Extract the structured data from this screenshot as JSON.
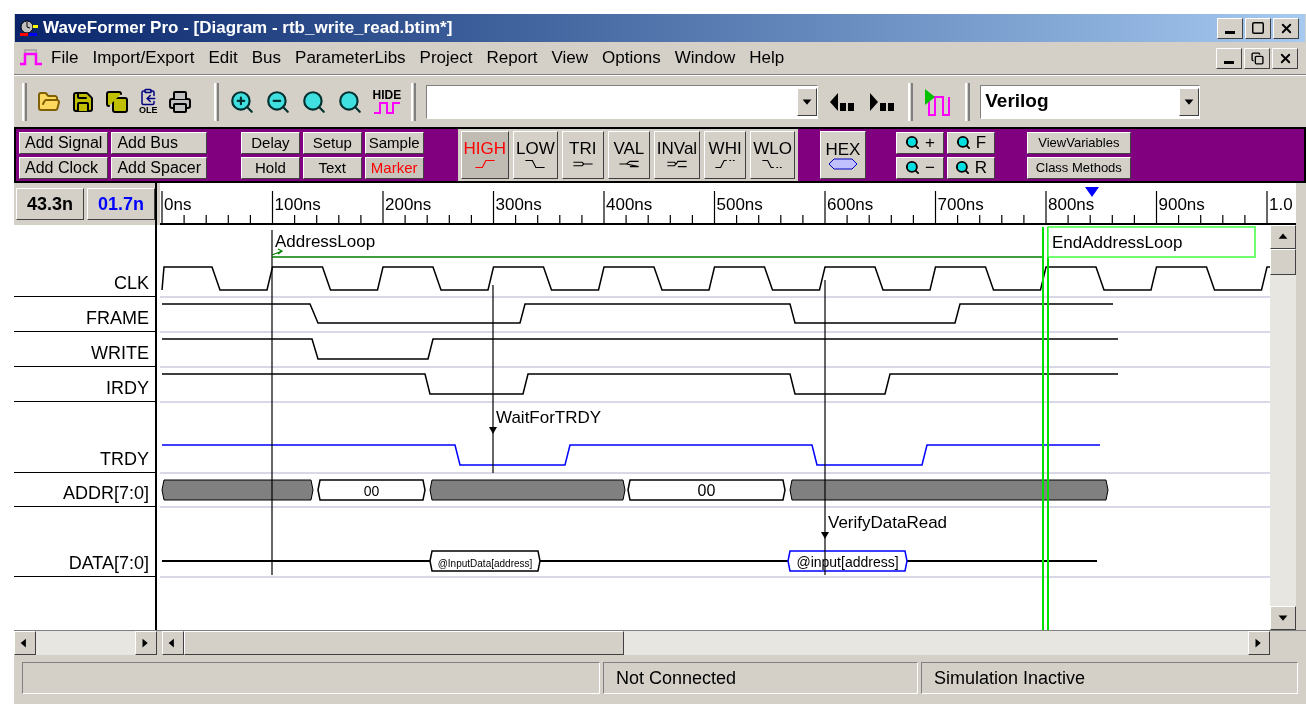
{
  "window": {
    "title": "WaveFormer Pro - [Diagram - rtb_write_read.btim*]"
  },
  "menu": [
    {
      "label": "File"
    },
    {
      "label": "Import/Export"
    },
    {
      "label": "Edit"
    },
    {
      "label": "Bus"
    },
    {
      "label": "ParameterLibs"
    },
    {
      "label": "Project"
    },
    {
      "label": "Report"
    },
    {
      "label": "View"
    },
    {
      "label": "Options"
    },
    {
      "label": "Window"
    },
    {
      "label": "Help"
    }
  ],
  "toolbar": {
    "hide_label": "HIDE",
    "ole_label": "OLE",
    "language": "Verilog"
  },
  "palette": {
    "add_buttons": [
      "Add Signal",
      "Add Bus",
      "Add Clock",
      "Add Spacer"
    ],
    "param_buttons": [
      {
        "label": "Delay",
        "selected": false
      },
      {
        "label": "Setup",
        "selected": false
      },
      {
        "label": "Sample",
        "selected": false
      },
      {
        "label": "Hold",
        "selected": false
      },
      {
        "label": "Text",
        "selected": false
      },
      {
        "label": "Marker",
        "selected": true
      }
    ],
    "state_buttons": [
      {
        "label": "HIGH",
        "selected": true
      },
      {
        "label": "LOW",
        "selected": false
      },
      {
        "label": "TRI",
        "selected": false
      },
      {
        "label": "VAL",
        "selected": false
      },
      {
        "label": "INVal",
        "selected": false
      },
      {
        "label": "WHI",
        "selected": false
      },
      {
        "label": "WLO",
        "selected": false
      }
    ],
    "hex_button": "HEX",
    "zoom_buttons": [
      "+",
      "F",
      "−",
      "R"
    ],
    "view_buttons": [
      "ViewVariables",
      "Class Methods"
    ]
  },
  "time_display": {
    "cursor": "43.3n",
    "delta": "01.7n"
  },
  "ruler": {
    "ticks": [
      "0ns",
      "100ns",
      "200ns",
      "300ns",
      "400ns",
      "500ns",
      "600ns",
      "700ns",
      "800ns",
      "900ns",
      "1.0"
    ]
  },
  "signals": [
    {
      "name": "CLK",
      "kind": "clock",
      "color": "#000000"
    },
    {
      "name": "FRAME",
      "kind": "bit",
      "color": "#000000"
    },
    {
      "name": "WRITE",
      "kind": "bit",
      "color": "#000000"
    },
    {
      "name": "IRDY",
      "kind": "bit",
      "color": "#000000"
    },
    {
      "name": "TRDY",
      "kind": "bit",
      "color": "#0000ff"
    },
    {
      "name": "ADDR[7:0]",
      "kind": "bus",
      "color": "#000000",
      "segments": [
        {
          "kind": "unknown"
        },
        {
          "kind": "value",
          "value": "00",
          "selected": false
        },
        {
          "kind": "unknown"
        },
        {
          "kind": "value",
          "value": "00",
          "selected": false
        },
        {
          "kind": "unknown"
        }
      ]
    },
    {
      "name": "DATA[7:0]",
      "kind": "bus",
      "color": "#000000",
      "segments": [
        {
          "kind": "z"
        },
        {
          "kind": "value",
          "value": "@InputData[address]",
          "selected": false
        },
        {
          "kind": "z"
        },
        {
          "kind": "value",
          "value": "@input[address]",
          "selected": true
        },
        {
          "kind": "z"
        }
      ]
    }
  ],
  "markers": [
    {
      "label": "AddressLoop",
      "kind": "loop_start"
    },
    {
      "label": "WaitForTRDY",
      "kind": "wait"
    },
    {
      "label": "VerifyDataRead",
      "kind": "wait"
    },
    {
      "label": "EndAddressLoop",
      "kind": "loop_end"
    }
  ],
  "status_bar": [
    "Not Connected",
    "Simulation Inactive"
  ]
}
